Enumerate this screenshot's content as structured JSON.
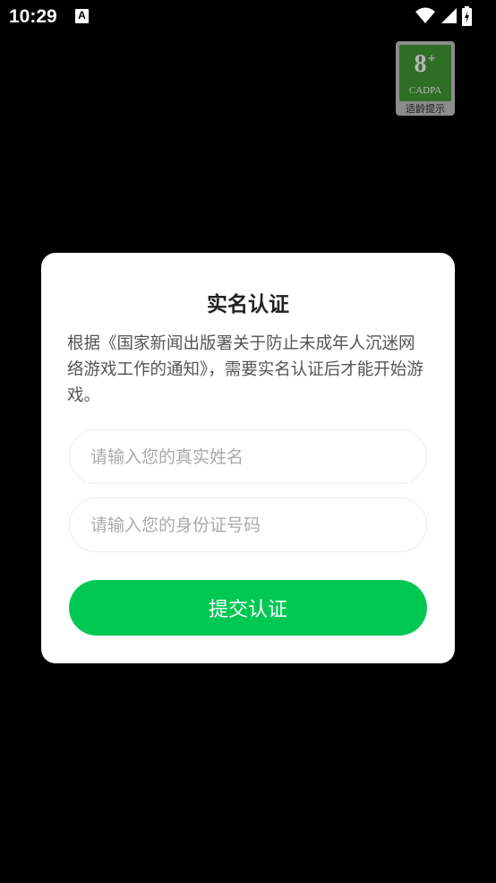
{
  "status_bar": {
    "time": "10:29",
    "app_icon_glyph": "A"
  },
  "age_badge": {
    "rating": "8",
    "plus": "+",
    "org": "CADPA",
    "caption": "适龄提示"
  },
  "dialog": {
    "title": "实名认证",
    "notice": "根据《国家新闻出版署关于防止未成年人沉迷网络游戏工作的通知》，需要实名认证后才能开始游戏。",
    "name_placeholder": "请输入您的真实姓名",
    "id_placeholder": "请输入您的身份证号码",
    "submit_label": "提交认证"
  },
  "colors": {
    "accent": "#00C853",
    "backdrop": "#000000",
    "badge_green": "#2F6E25"
  }
}
